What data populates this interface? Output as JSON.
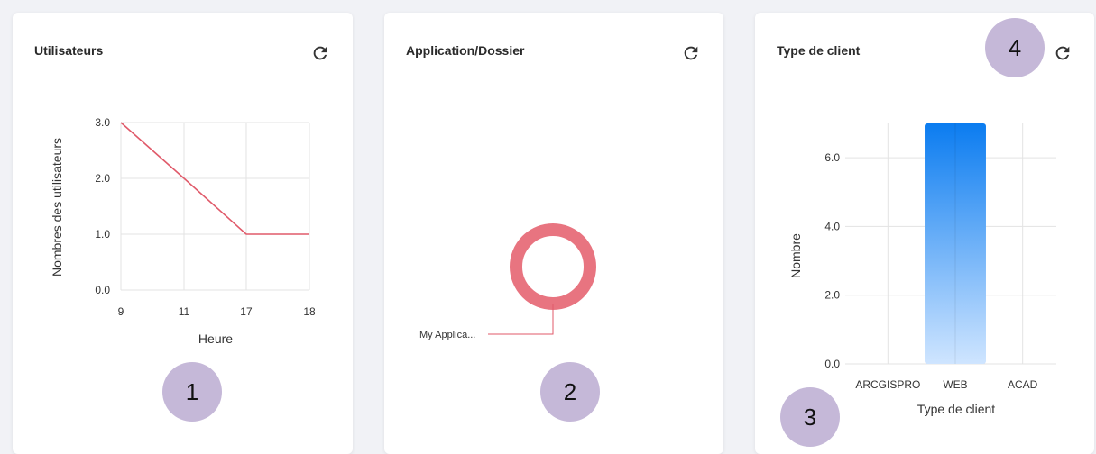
{
  "cards": [
    {
      "title": "Utilisateurs"
    },
    {
      "title": "Application/Dossier"
    },
    {
      "title": "Type de client"
    }
  ],
  "badges": [
    "1",
    "2",
    "3",
    "4"
  ],
  "colors": {
    "line": "#e05a6a",
    "donut": "#e87480",
    "bar_top": "#0b7cf0",
    "bar_bottom": "#cfe5ff",
    "grid": "#e3e3e3"
  },
  "chart_data": [
    {
      "type": "line",
      "categories": [
        "9",
        "11",
        "17",
        "18"
      ],
      "values": [
        3,
        2,
        1,
        1
      ],
      "xlabel": "Heure",
      "ylabel": "Nombres des utilisateurs",
      "yticks": [
        "0.0",
        "1.0",
        "2.0",
        "3.0"
      ],
      "ylim": [
        0,
        3
      ],
      "grid": true
    },
    {
      "type": "pie",
      "labels": [
        "My Applica..."
      ],
      "values": [
        1
      ]
    },
    {
      "type": "bar",
      "categories": [
        "ARCGISPRO",
        "WEB",
        "ACAD"
      ],
      "values": [
        0,
        7,
        0
      ],
      "xlabel": "Type de client",
      "ylabel": "Nombre",
      "yticks": [
        "0.0",
        "2.0",
        "4.0",
        "6.0"
      ],
      "ylim": [
        0,
        7
      ],
      "grid": true
    }
  ]
}
